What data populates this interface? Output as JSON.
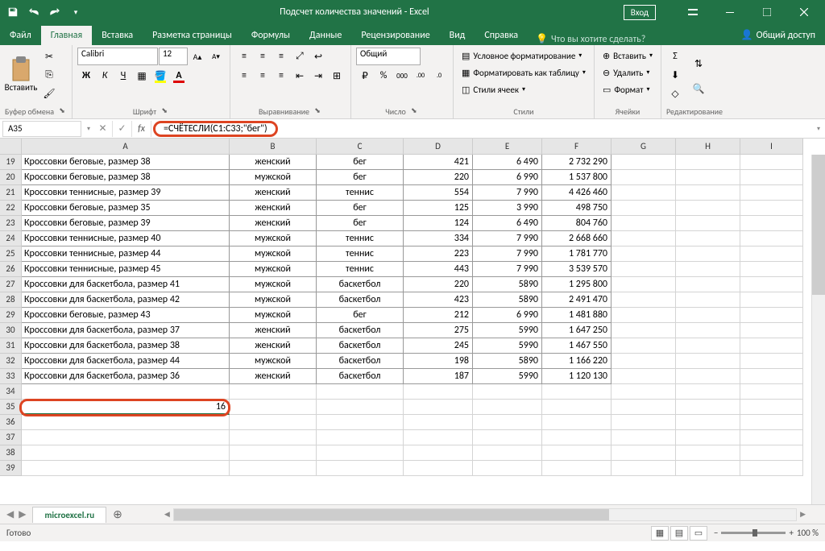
{
  "titlebar": {
    "title": "Подсчет количества значений  -  Excel",
    "login": "Вход"
  },
  "tabs": {
    "file": "Файл",
    "home": "Главная",
    "insert": "Вставка",
    "layout": "Разметка страницы",
    "formulas": "Формулы",
    "data": "Данные",
    "review": "Рецензирование",
    "view": "Вид",
    "help": "Справка",
    "tellme": "Что вы хотите сделать?",
    "share": "Общий доступ"
  },
  "ribbon": {
    "clipboard": {
      "label": "Буфер обмена",
      "paste": "Вставить"
    },
    "font": {
      "label": "Шрифт",
      "name": "Calibri",
      "size": "12"
    },
    "alignment": {
      "label": "Выравнивание"
    },
    "number": {
      "label": "Число",
      "format": "Общий"
    },
    "styles": {
      "label": "Стили",
      "cond": "Условное форматирование",
      "table": "Форматировать как таблицу",
      "cell": "Стили ячеек"
    },
    "cells": {
      "label": "Ячейки",
      "insert": "Вставить",
      "delete": "Удалить",
      "format": "Формат"
    },
    "editing": {
      "label": "Редактирование"
    }
  },
  "formula_bar": {
    "name_box": "A35",
    "formula": "=СЧЁТЕСЛИ(C1:C33;\"бег\")"
  },
  "columns": [
    "A",
    "B",
    "C",
    "D",
    "E",
    "F",
    "G",
    "H",
    "I"
  ],
  "rows": [
    {
      "n": 19,
      "a": "Кроссовки беговые, размер 38",
      "b": "женский",
      "c": "бег",
      "d": "421",
      "e": "6 490",
      "f": "2 732 290"
    },
    {
      "n": 20,
      "a": "Кроссовки беговые, размер 38",
      "b": "мужской",
      "c": "бег",
      "d": "220",
      "e": "6 990",
      "f": "1 537 800"
    },
    {
      "n": 21,
      "a": "Кроссовки теннисные, размер 39",
      "b": "женский",
      "c": "теннис",
      "d": "554",
      "e": "7 990",
      "f": "4 426 460"
    },
    {
      "n": 22,
      "a": "Кроссовки беговые, размер 35",
      "b": "женский",
      "c": "бег",
      "d": "125",
      "e": "3 990",
      "f": "498 750"
    },
    {
      "n": 23,
      "a": "Кроссовки беговые, размер 39",
      "b": "женский",
      "c": "бег",
      "d": "124",
      "e": "6 490",
      "f": "804 760"
    },
    {
      "n": 24,
      "a": "Кроссовки теннисные, размер 40",
      "b": "мужской",
      "c": "теннис",
      "d": "334",
      "e": "7 990",
      "f": "2 668 660"
    },
    {
      "n": 25,
      "a": "Кроссовки теннисные, размер 44",
      "b": "мужской",
      "c": "теннис",
      "d": "223",
      "e": "7 990",
      "f": "1 781 770"
    },
    {
      "n": 26,
      "a": "Кроссовки теннисные, размер 45",
      "b": "мужской",
      "c": "теннис",
      "d": "443",
      "e": "7 990",
      "f": "3 539 570"
    },
    {
      "n": 27,
      "a": "Кроссовки для баскетбола, размер 41",
      "b": "мужской",
      "c": "баскетбол",
      "d": "220",
      "e": "5890",
      "f": "1 295 800"
    },
    {
      "n": 28,
      "a": "Кроссовки для баскетбола, размер 42",
      "b": "мужской",
      "c": "баскетбол",
      "d": "423",
      "e": "5890",
      "f": "2 491 470"
    },
    {
      "n": 29,
      "a": "Кроссовки беговые, размер 43",
      "b": "мужской",
      "c": "бег",
      "d": "212",
      "e": "6 990",
      "f": "1 481 880"
    },
    {
      "n": 30,
      "a": "Кроссовки для баскетбола, размер 37",
      "b": "женский",
      "c": "баскетбол",
      "d": "275",
      "e": "5990",
      "f": "1 647 250"
    },
    {
      "n": 31,
      "a": "Кроссовки для баскетбола, размер 38",
      "b": "женский",
      "c": "баскетбол",
      "d": "245",
      "e": "5990",
      "f": "1 467 550"
    },
    {
      "n": 32,
      "a": "Кроссовки для баскетбола, размер 44",
      "b": "мужской",
      "c": "баскетбол",
      "d": "198",
      "e": "5890",
      "f": "1 166 220"
    },
    {
      "n": 33,
      "a": "Кроссовки для баскетбола, размер 36",
      "b": "женский",
      "c": "баскетбол",
      "d": "187",
      "e": "5990",
      "f": "1 120 130"
    }
  ],
  "empty_rows": [
    34,
    35,
    36,
    37,
    38,
    39
  ],
  "result_cell": {
    "row": 35,
    "value": "16"
  },
  "sheet": {
    "name": "microexcel.ru"
  },
  "statusbar": {
    "ready": "Готово",
    "zoom": "100 %"
  }
}
